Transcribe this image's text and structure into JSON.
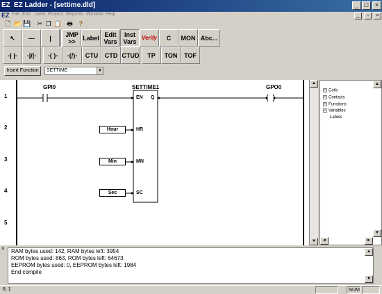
{
  "window": {
    "logo": "EZ",
    "title": "EZ Ladder - [settime.dld]",
    "controls": [
      "_",
      "□",
      "×"
    ]
  },
  "menu": {
    "logo": "EZ",
    "items": [
      "File",
      "Edit",
      "View",
      "Project",
      "Reports",
      "Window",
      "Help"
    ]
  },
  "toolbar1": {
    "icons": [
      "new-file-icon",
      "open-folder-icon",
      "save-icon",
      "cut-icon",
      "copy-icon",
      "paste-icon",
      "print-icon",
      "help-icon"
    ]
  },
  "toolbar2": {
    "buttons": [
      "↖",
      "---",
      "|",
      "JMP\n>>",
      "Label",
      "Edit\nVars",
      "Inst\nVars",
      "Verify",
      "C",
      "MON",
      "Abc..."
    ]
  },
  "toolbar3": {
    "buttons": [
      "-| |-",
      "-|/|-",
      "-( )-",
      "-(/)-",
      "CTU",
      "CTD",
      "CTUD",
      "TP",
      "TON",
      "TOF"
    ]
  },
  "function_bar": {
    "insert_label": "Insert Function",
    "selected": "SETTIME"
  },
  "ladder": {
    "rungs": [
      "1",
      "2",
      "3",
      "4",
      "5"
    ],
    "contact_label": "GPI0",
    "block_title": "SETTIME1",
    "block_inputs": [
      "EN",
      "HR",
      "MN",
      "SC"
    ],
    "block_output": "Q",
    "coil_label": "GPO0",
    "var_boxes": [
      "Hour",
      "Min",
      "Sec"
    ]
  },
  "tree": {
    "items": [
      {
        "label": "Coils",
        "expandable": true
      },
      {
        "label": "Contacts",
        "expandable": true
      },
      {
        "label": "Functions",
        "expandable": true
      },
      {
        "label": "Variables",
        "expandable": true
      },
      {
        "label": "Labels",
        "expandable": false
      }
    ]
  },
  "output": {
    "lines": [
      "RAM bytes used: 142, RAM bytes left: 3954",
      "ROM bytes used: 863, ROM bytes left: 64673",
      "EEPROM bytes used: 0, EEPROM bytes left: 1984",
      "End compile"
    ]
  },
  "status": {
    "position": "8, 1",
    "num": "NUM"
  }
}
